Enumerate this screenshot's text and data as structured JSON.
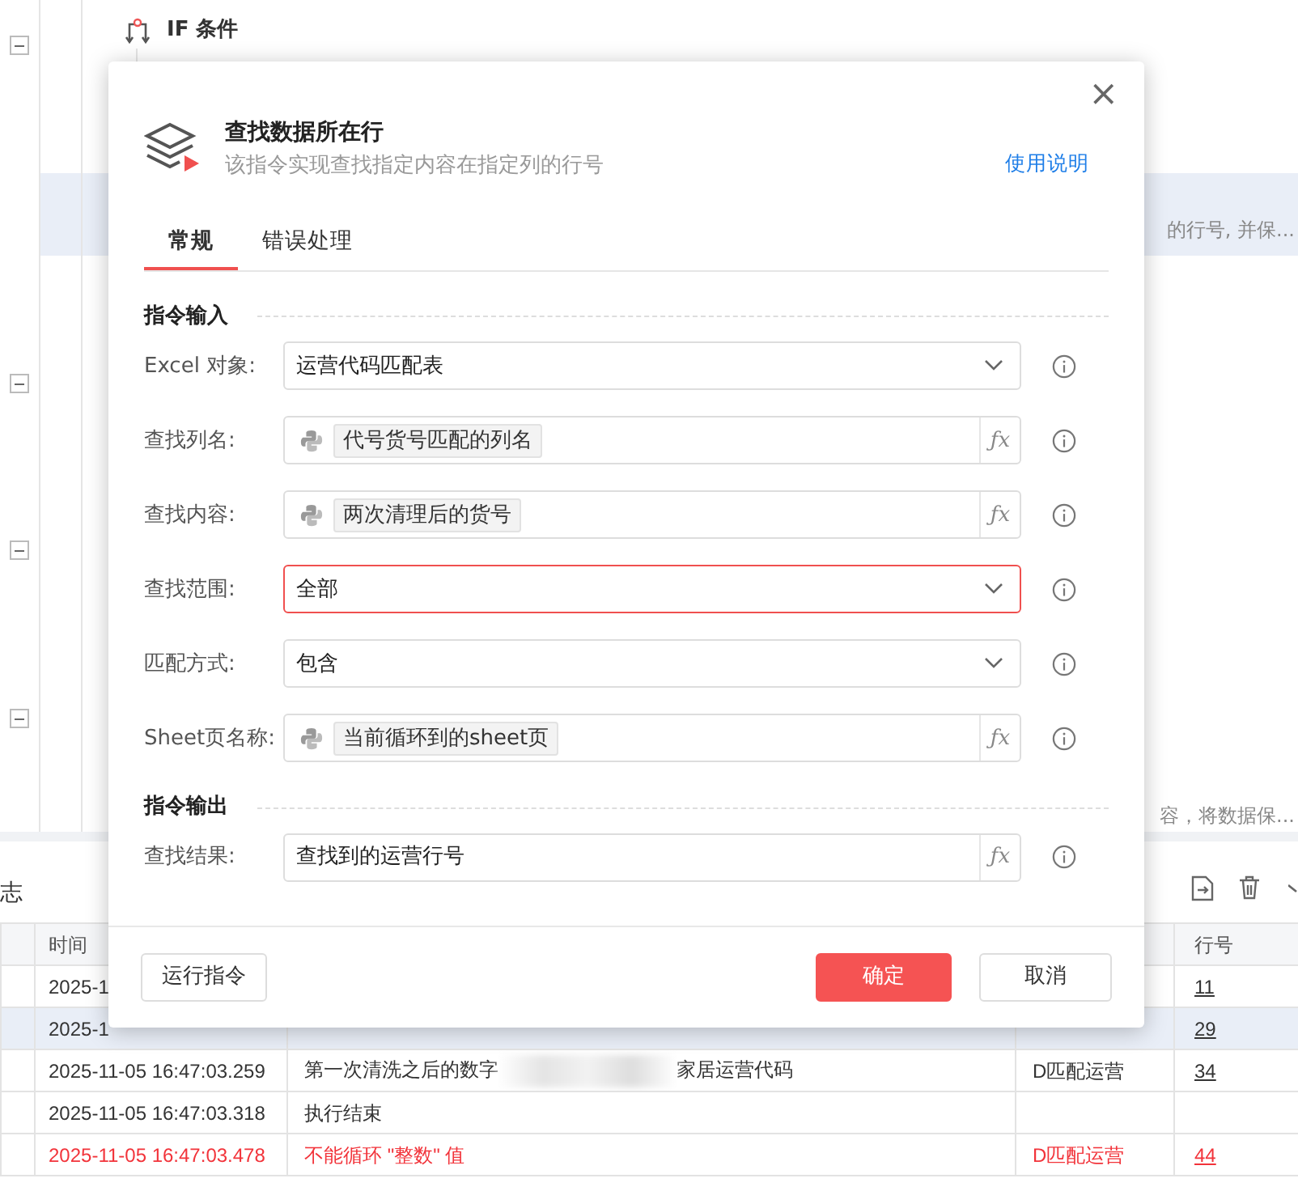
{
  "background": {
    "flow_block": {
      "title": "IF 条件"
    },
    "faded_texts": [
      "的行号, 并保...",
      "容，将数据保..."
    ]
  },
  "log_panel": {
    "title": "志",
    "columns": [
      "时间",
      "行号"
    ],
    "rows": [
      {
        "time": "2025-1",
        "message": "",
        "row_number": "11",
        "error": false,
        "selected": false
      },
      {
        "time": "2025-1",
        "message": "",
        "row_number": "29",
        "error": false,
        "selected": true
      },
      {
        "time": "2025-11-05 16:47:03.259",
        "message": "第一次清洗之后的数字",
        "message_tail": "家居运营代码",
        "category": "D匹配运营",
        "row_number": "34",
        "error": false,
        "selected": false
      },
      {
        "time": "2025-11-05 16:47:03.318",
        "message": "执行结束",
        "category": "",
        "row_number": "",
        "error": false,
        "selected": false
      },
      {
        "time": "2025-11-05 16:47:03.478",
        "message": "不能循环 \"整数\" 值",
        "category": "D匹配运营",
        "row_number": "44",
        "error": true,
        "selected": false
      }
    ]
  },
  "dialog": {
    "title": "查找数据所在行",
    "subtitle": "该指令实现查找指定内容在指定列的行号",
    "help_link": "使用说明",
    "close": "×",
    "tabs": [
      {
        "label": "常规",
        "selected": true
      },
      {
        "label": "错误处理",
        "selected": false
      }
    ],
    "sections": [
      {
        "title": "指令输入",
        "fields": [
          {
            "label": "Excel 对象:",
            "kind": "select",
            "value": "运营代码匹配表",
            "error": false
          },
          {
            "label": "查找列名:",
            "kind": "variable",
            "value": "代号货号匹配的列名",
            "function_button": "ƒx",
            "error": false
          },
          {
            "label": "查找内容:",
            "kind": "variable",
            "value": "两次清理后的货号",
            "function_button": "ƒx",
            "error": false
          },
          {
            "label": "查找范围:",
            "kind": "select",
            "value": "全部",
            "error": true
          },
          {
            "label": "匹配方式:",
            "kind": "select",
            "value": "包含",
            "error": false
          },
          {
            "label": "Sheet页名称:",
            "kind": "variable",
            "value": "当前循环到的sheet页",
            "function_button": "ƒx",
            "error": false
          }
        ]
      },
      {
        "title": "指令输出",
        "fields": [
          {
            "label": "查找结果:",
            "kind": "text",
            "value": "查找到的运营行号",
            "function_button": "ƒx",
            "error": false
          }
        ]
      }
    ],
    "buttons": [
      {
        "label": "运行指令",
        "kind": "default"
      },
      {
        "label": "确定",
        "kind": "primary"
      },
      {
        "label": "取消",
        "kind": "default"
      }
    ]
  }
}
